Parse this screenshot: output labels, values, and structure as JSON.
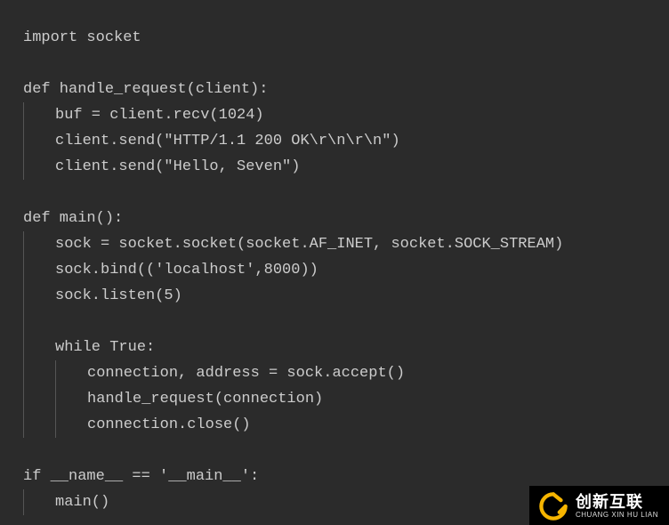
{
  "code": {
    "lines": [
      {
        "indent": 0,
        "text": "import socket"
      },
      {
        "indent": 0,
        "text": ""
      },
      {
        "indent": 0,
        "text": "def handle_request(client):"
      },
      {
        "indent": 1,
        "text": "buf = client.recv(1024)"
      },
      {
        "indent": 1,
        "text": "client.send(\"HTTP/1.1 200 OK\\r\\n\\r\\n\")"
      },
      {
        "indent": 1,
        "text": "client.send(\"Hello, Seven\")"
      },
      {
        "indent": 0,
        "text": ""
      },
      {
        "indent": 0,
        "text": "def main():"
      },
      {
        "indent": 1,
        "text": "sock = socket.socket(socket.AF_INET, socket.SOCK_STREAM)"
      },
      {
        "indent": 1,
        "text": "sock.bind(('localhost',8000))"
      },
      {
        "indent": 1,
        "text": "sock.listen(5)"
      },
      {
        "indent": 1,
        "text": "",
        "blank_inside": true
      },
      {
        "indent": 1,
        "text": "while True:"
      },
      {
        "indent": 2,
        "text": "connection, address = sock.accept()"
      },
      {
        "indent": 2,
        "text": "handle_request(connection)"
      },
      {
        "indent": 2,
        "text": "connection.close()"
      },
      {
        "indent": 0,
        "text": ""
      },
      {
        "indent": 0,
        "text": "if __name__ == '__main__':"
      },
      {
        "indent": 1,
        "text": "main()"
      }
    ]
  },
  "watermark": {
    "title": "创新互联",
    "subtitle": "CHUANG XIN HU LIAN"
  }
}
